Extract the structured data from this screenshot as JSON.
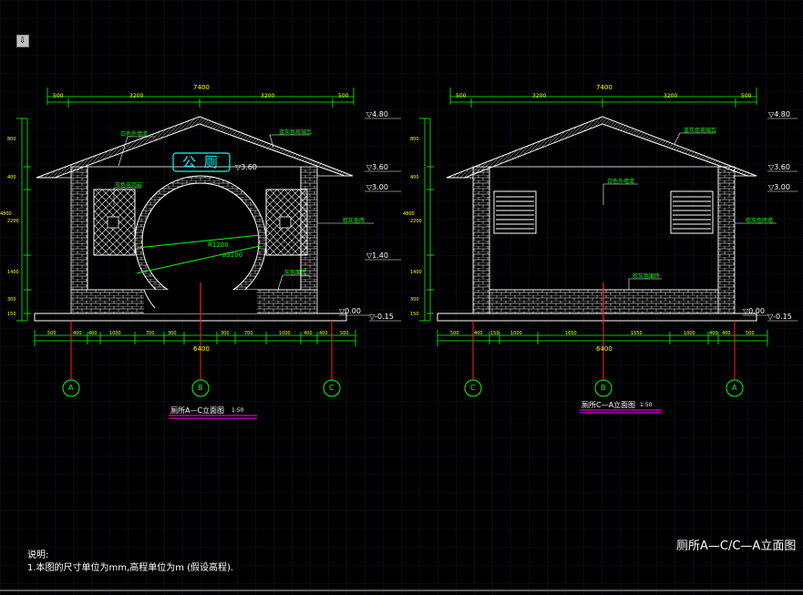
{
  "toolbar": {
    "menu_icon": "dropdown-arrow-icon"
  },
  "colors": {
    "bg": "#000000",
    "grid": "#1a1a3a",
    "wall": "#ffffff",
    "dim": "#00ff00",
    "text_dim": "#ffff00",
    "axis": "#00ff00",
    "red": "#ff2020",
    "magenta": "#ff00ff",
    "cyan": "#00ffff",
    "label": "#00ff00"
  },
  "left_view": {
    "title": "厕所A—C立面图",
    "scale": "1:50",
    "sign_text": "公 厕",
    "top_total": "7400",
    "top_dims": [
      "500",
      "3200",
      "3200",
      "500"
    ],
    "bottom_total": "6400",
    "bottom_dims": [
      "500",
      "400",
      "400",
      "1000",
      "700",
      "300",
      "300",
      "700",
      "1000",
      "400",
      "400",
      "500"
    ],
    "left_dims": [
      "800",
      "400",
      "2200",
      "1400",
      "300",
      "150"
    ],
    "left_total": "4800",
    "circle_label_1": "R1200",
    "circle_label_2": "⌀3100",
    "callouts": [
      "白色外墙漆",
      "蓝灰色琉璃瓦",
      "灰色花岗岩",
      "棕灰色砖",
      "灰色面砖",
      "白色外墙漆"
    ],
    "levels": [
      "▽4.80",
      "▽3.60",
      "▽3.00",
      "▽1.40",
      "▽0.00",
      "▽-0.15",
      "▽3.60"
    ],
    "axes": [
      "A",
      "B",
      "C"
    ]
  },
  "right_view": {
    "title": "厕所C—A立面图",
    "scale": "1:50",
    "top_total": "7400",
    "top_dims": [
      "500",
      "3200",
      "3200",
      "500"
    ],
    "bottom_total": "6400",
    "bottom_dims": [
      "500",
      "400",
      "150",
      "1000",
      "1650",
      "1650",
      "1000",
      "400",
      "400",
      "500"
    ],
    "left_dims": [
      "800",
      "400",
      "2200",
      "1400",
      "300",
      "150"
    ],
    "left_total": "4800",
    "callouts": [
      "蓝灰色琉璃瓦",
      "白色外墙漆",
      "棕灰色砖墙",
      "棕灰色面砖"
    ],
    "levels": [
      "▽4.80",
      "▽3.60",
      "▽3.00",
      "▽0.00",
      "▽-0.15"
    ],
    "axes": [
      "C",
      "B",
      "A"
    ]
  },
  "notes": {
    "heading": "说明:",
    "line1": "1.本图的尺寸单位为mm,高程单位为m (假设高程)."
  },
  "sheet_title": "厕所A—C/C—A立面图"
}
